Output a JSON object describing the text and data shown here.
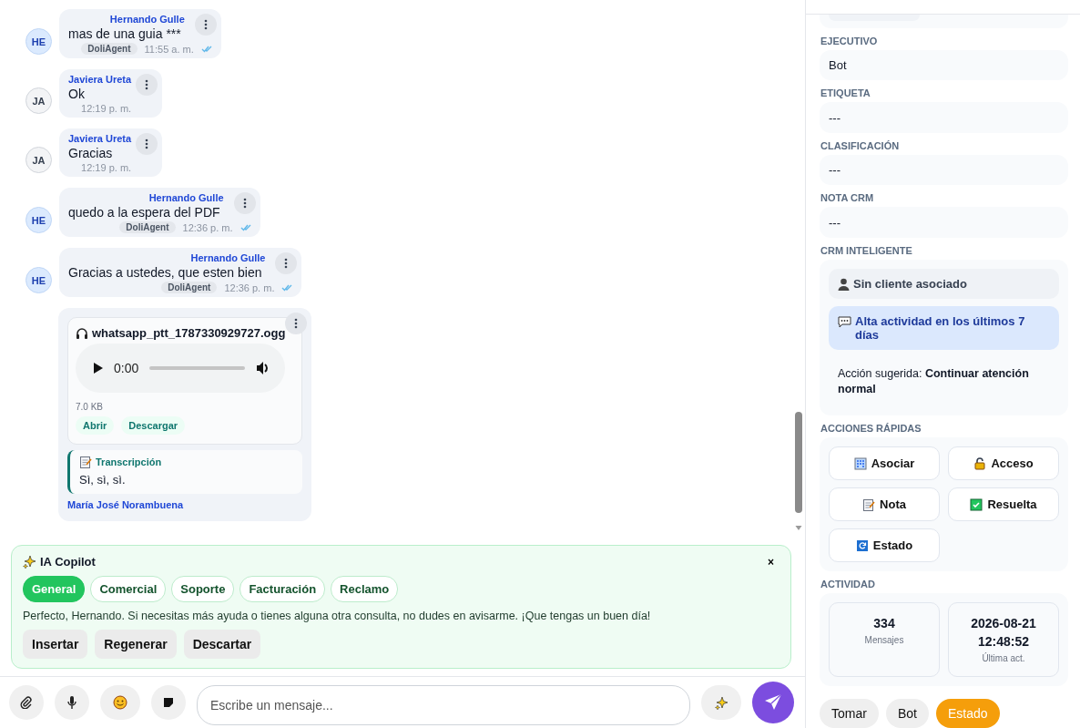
{
  "chat": {
    "messages": [
      {
        "kind": "agent",
        "initials": "HE",
        "author": "Hernando Gulle",
        "text": "mas de una guia ***",
        "badge": "DoliAgent",
        "time": "11:55 a. m.",
        "read": true
      },
      {
        "kind": "client",
        "initials": "JA",
        "author": "Javiera Ureta",
        "text": "Ok",
        "time": "12:19 p. m."
      },
      {
        "kind": "client",
        "initials": "JA",
        "author": "Javiera Ureta",
        "text": "Gracias",
        "time": "12:19 p. m."
      },
      {
        "kind": "agent",
        "initials": "HE",
        "author": "Hernando Gulle",
        "text": "quedo a la espera del PDF",
        "badge": "DoliAgent",
        "time": "12:36 p. m.",
        "read": true
      },
      {
        "kind": "agent",
        "initials": "HE",
        "author": "Hernando Gulle",
        "text": "Gracias a ustedes, que esten bien",
        "badge": "DoliAgent",
        "time": "12:36 p. m.",
        "read": true
      },
      {
        "kind": "audio",
        "file": "whatsapp_ptt_1787330929727.ogg",
        "player_time": "0:00",
        "size": "7.0 KB",
        "actions": [
          "Abrir",
          "Descargar"
        ],
        "transcription_label": "Transcripción",
        "transcription": "Sì, sì, sì.",
        "author": "María José Norambuena"
      }
    ]
  },
  "copilot": {
    "title": "IA Copilot",
    "close": "×",
    "tabs": [
      {
        "label": "General",
        "selected": true
      },
      {
        "label": "Comercial",
        "selected": false
      },
      {
        "label": "Soporte",
        "selected": false
      },
      {
        "label": "Facturación",
        "selected": false
      },
      {
        "label": "Reclamo",
        "selected": false
      }
    ],
    "suggestion": "Perfecto, Hernando. Si necesitas más ayuda o tienes alguna otra consulta, no dudes en avisarme. ¡Que tengas un buen día!",
    "actions": [
      "Insertar",
      "Regenerar",
      "Descartar"
    ]
  },
  "composer": {
    "placeholder": "Escribe un mensaje..."
  },
  "sidebar": {
    "fields": [
      {
        "label": "EJECUTIVO",
        "value": "Bot"
      },
      {
        "label": "ETIQUETA",
        "value": "---"
      },
      {
        "label": "CLASIFICACIÓN",
        "value": "---"
      },
      {
        "label": "NOTA CRM",
        "value": "---"
      }
    ],
    "crm": {
      "label": "CRM INTELIGENTE",
      "client_status": "Sin cliente asociado",
      "insight": "Alta actividad en los últimos 7 días",
      "suggestion": "Acción sugerida: **Continuar atención normal**"
    },
    "quick_actions": {
      "label": "ACCIONES RÁPIDAS",
      "buttons": [
        {
          "kind": "building",
          "label": "Asociar"
        },
        {
          "kind": "lock",
          "label": "Acceso"
        },
        {
          "kind": "note",
          "label": "Nota"
        },
        {
          "kind": "check",
          "label": "Resuelta"
        },
        {
          "kind": "refresh",
          "label": "Estado"
        }
      ]
    },
    "activity": {
      "label": "ACTIVIDAD",
      "stats": [
        {
          "value": "334",
          "caption": "Mensajes"
        },
        {
          "value": "2026-08-21 12:48:52",
          "caption": "Última act."
        }
      ]
    },
    "footer_buttons": [
      {
        "kind": "neutral",
        "label": "Tomar"
      },
      {
        "kind": "neutral",
        "label": "Bot"
      },
      {
        "kind": "primary",
        "label": "Estado"
      }
    ]
  }
}
